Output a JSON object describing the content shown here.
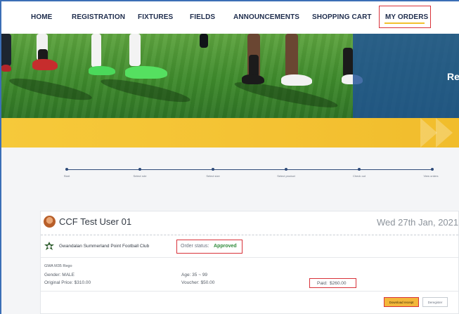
{
  "nav": {
    "items": [
      {
        "label": "HOME"
      },
      {
        "label": "REGISTRATION"
      },
      {
        "label": "FIXTURES"
      },
      {
        "label": "FIELDS"
      },
      {
        "label": "ANNOUNCEMENTS"
      },
      {
        "label": "SHOPPING CART"
      },
      {
        "label": "MY ORDERS"
      }
    ],
    "active": "MY ORDERS"
  },
  "hero": {
    "text": "Re"
  },
  "stepper": {
    "steps": [
      {
        "label": "Start"
      },
      {
        "label": "Select role"
      },
      {
        "label": "Select size"
      },
      {
        "label": "Select product"
      },
      {
        "label": "Check out"
      },
      {
        "label": "View orders"
      }
    ]
  },
  "order": {
    "user_name": "CCF Test User 01",
    "date": "Wed 27th Jan, 2021",
    "club": "Gwandalan Summerland Point Football Club",
    "status_label": "Order status:",
    "status_value": "Approved",
    "product": "GWA M35 Rego",
    "gender": "Gender: MALE",
    "age": "Age: 35 ~ 99",
    "original_price": "Original Price: $310.00",
    "voucher": "Voucher: $50.00",
    "paid_label": "Paid:",
    "paid_value": "$260.00",
    "download_button": "Download receipt",
    "deregister_button": "Deregister"
  },
  "colors": {
    "nav_text": "#1f2d4d",
    "highlight_border": "#d8323a",
    "accent_yellow": "#f4c233",
    "status_green": "#2f8a3a",
    "panel_blue": "#1e5096"
  }
}
